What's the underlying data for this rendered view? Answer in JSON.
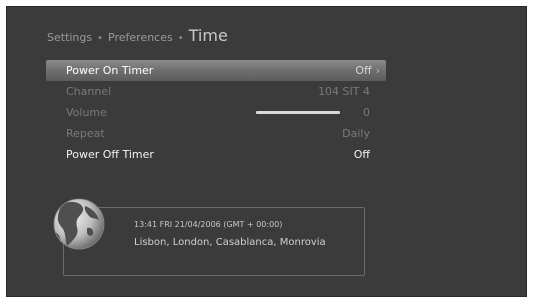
{
  "breadcrumb": {
    "items": [
      "Settings",
      "Preferences"
    ],
    "separator": "•",
    "current": "Time"
  },
  "menu": [
    {
      "label": "Power On Timer",
      "value": "Off",
      "state": "selected",
      "chevron": "›"
    },
    {
      "label": "Channel",
      "value": "104 SIT 4",
      "state": "disabled"
    },
    {
      "label": "Volume",
      "value": "0",
      "state": "disabled",
      "slider_level": 1.0
    },
    {
      "label": "Repeat",
      "value": "Daily",
      "state": "disabled"
    },
    {
      "label": "Power Off Timer",
      "value": "Off",
      "state": "enabled"
    }
  ],
  "info": {
    "time": "13:41 FRI 21/04/2006 (GMT + 00:00)",
    "cities": "Lisbon, London, Casablanca, Monrovia",
    "icon": "globe-icon"
  },
  "colors": {
    "background": "#3b3b3b",
    "highlight": "#7a7a7a"
  }
}
